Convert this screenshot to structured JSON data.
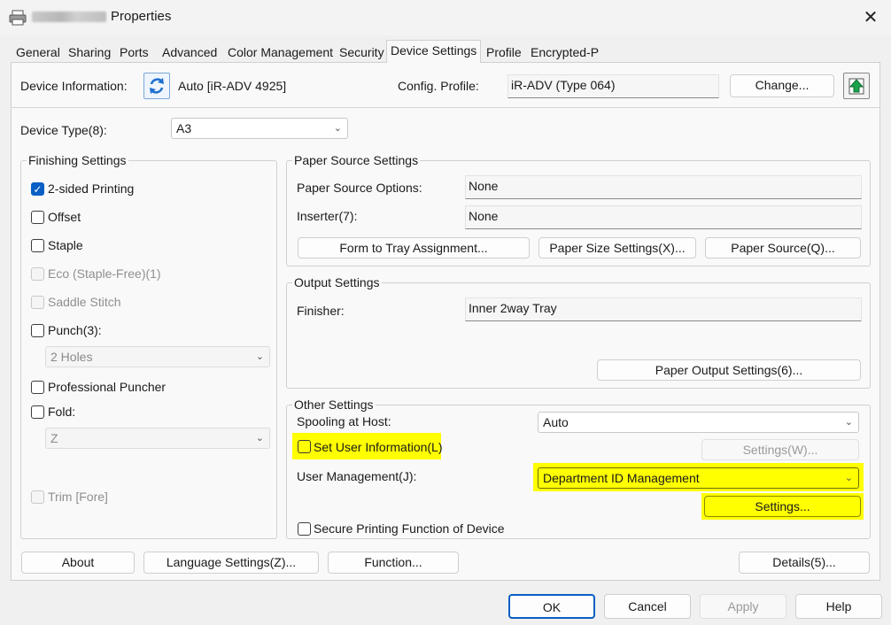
{
  "window": {
    "title": "Properties",
    "close": "✕"
  },
  "tabs": [
    "General",
    "Sharing",
    "Ports",
    "Advanced",
    "Color Management",
    "Security",
    "Device Settings",
    "Profile",
    "Encrypted-P"
  ],
  "device_info": {
    "label": "Device Information:",
    "value": "Auto [iR-ADV 4925]",
    "config_label": "Config. Profile:",
    "config_value": "iR-ADV (Type 064)",
    "change_btn": "Change..."
  },
  "device_type": {
    "label": "Device Type(8):",
    "value": "A3"
  },
  "finishing": {
    "title": "Finishing Settings",
    "two_sided": "2-sided Printing",
    "offset": "Offset",
    "staple": "Staple",
    "eco": "Eco (Staple-Free)(1)",
    "saddle": "Saddle Stitch",
    "punch": "Punch(3):",
    "punch_value": "2 Holes",
    "pro_puncher": "Professional Puncher",
    "fold": "Fold:",
    "fold_value": "Z",
    "trim": "Trim [Fore]"
  },
  "paper_source": {
    "title": "Paper Source Settings",
    "options_label": "Paper Source Options:",
    "options_value": "None",
    "inserter_label": "Inserter(7):",
    "inserter_value": "None",
    "btn_form": "Form to Tray Assignment...",
    "btn_size": "Paper Size Settings(X)...",
    "btn_source": "Paper Source(Q)..."
  },
  "output": {
    "title": "Output Settings",
    "finisher_label": "Finisher:",
    "finisher_value": "Inner 2way Tray",
    "btn": "Paper Output Settings(6)..."
  },
  "other": {
    "title": "Other Settings",
    "spool_label": "Spooling at Host:",
    "spool_value": "Auto",
    "set_user": "Set User Information(L)",
    "settings_w": "Settings(W)...",
    "user_mgmt_label": "User Management(J):",
    "user_mgmt_value": "Department ID Management",
    "settings_btn": "Settings...",
    "secure": "Secure Printing Function of Device"
  },
  "footer_buttons": {
    "about": "About",
    "language": "Language Settings(Z)...",
    "function": "Function...",
    "details": "Details(5)..."
  },
  "dialog_buttons": {
    "ok": "OK",
    "cancel": "Cancel",
    "apply": "Apply",
    "help": "Help"
  },
  "colors": {
    "highlight": "#ffff00",
    "accent": "#0a5fc4"
  }
}
